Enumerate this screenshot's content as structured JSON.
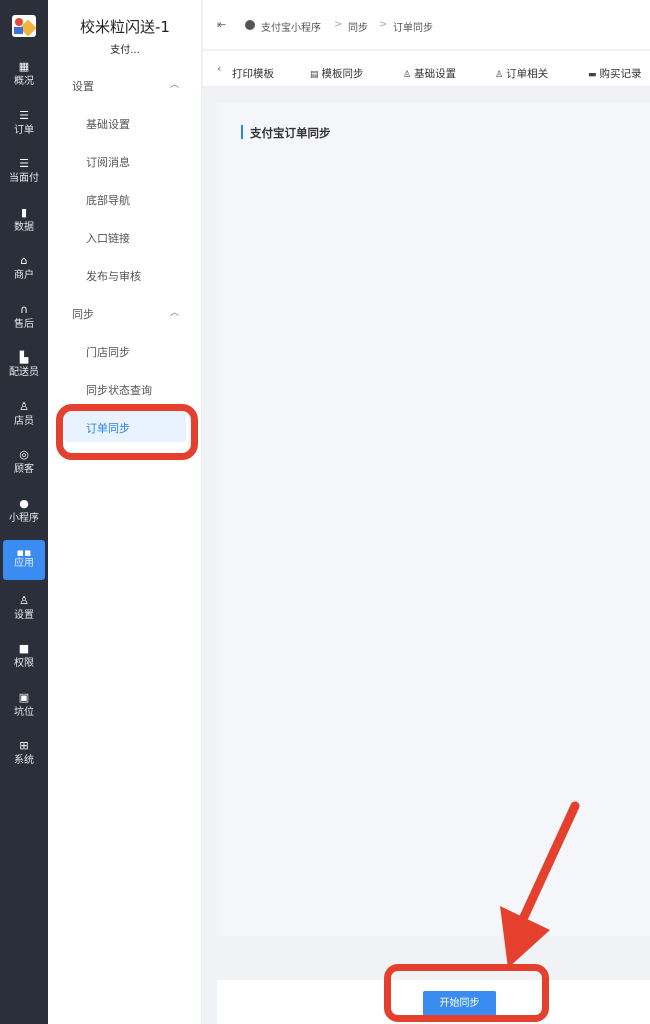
{
  "rail": {
    "items": [
      {
        "label": "概况",
        "icon": "overview-icon"
      },
      {
        "label": "订单",
        "icon": "order-icon"
      },
      {
        "label": "当面付",
        "icon": "face-pay-icon"
      },
      {
        "label": "数据",
        "icon": "data-icon"
      },
      {
        "label": "商户",
        "icon": "merchant-icon"
      },
      {
        "label": "售后",
        "icon": "after-sales-icon"
      },
      {
        "label": "配送员",
        "icon": "courier-icon"
      },
      {
        "label": "店员",
        "icon": "staff-icon"
      },
      {
        "label": "顾客",
        "icon": "customer-icon"
      },
      {
        "label": "小程序",
        "icon": "mini-program-icon"
      },
      {
        "label": "应用",
        "icon": "apps-icon",
        "active": true
      },
      {
        "label": "设置",
        "icon": "settings-icon"
      },
      {
        "label": "权限",
        "icon": "lock-icon"
      },
      {
        "label": "坑位",
        "icon": "slot-icon"
      },
      {
        "label": "系统",
        "icon": "windows-icon"
      }
    ]
  },
  "subnav": {
    "app_title": "校米粒闪送-1",
    "app_subtitle": "支付...",
    "groups": [
      {
        "label": "设置",
        "items": [
          "基础设置",
          "订阅消息",
          "底部导航",
          "入口链接",
          "发布与审核"
        ]
      },
      {
        "label": "同步",
        "items": [
          "门店同步",
          "同步状态查询",
          "订单同步"
        ]
      }
    ],
    "active_item": "订单同步"
  },
  "breadcrumb": [
    "支付宝小程序",
    "同步",
    "订单同步"
  ],
  "tabs": [
    "打印模板",
    "模板同步",
    "基础设置",
    "订单相关",
    "购买记录"
  ],
  "content": {
    "section_title": "支付宝订单同步",
    "start_button": "开始同步"
  },
  "colors": {
    "rail_bg": "#2b2f3a",
    "accent": "#3b8cf0",
    "annotation": "#e5402e"
  }
}
